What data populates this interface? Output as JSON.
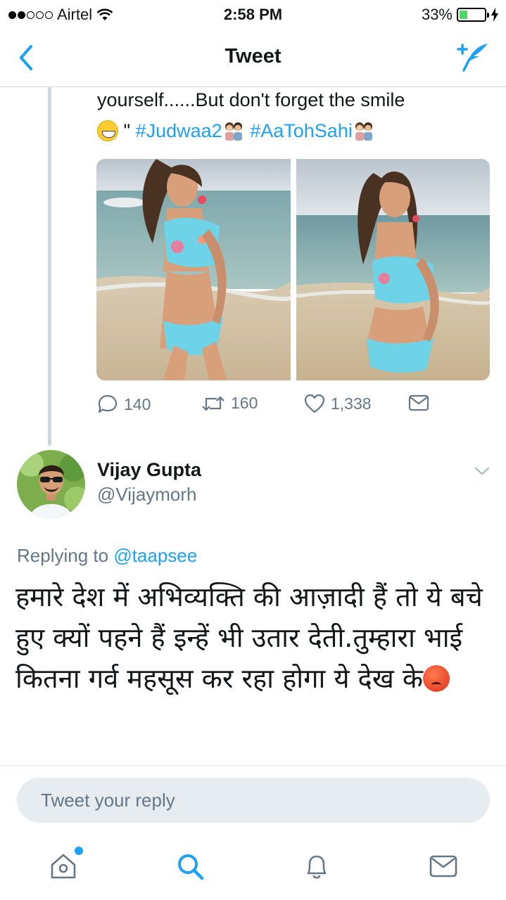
{
  "status_bar": {
    "carrier": "Airtel",
    "time": "2:58 PM",
    "battery": "33%",
    "battery_level": 0.33
  },
  "nav": {
    "title": "Tweet",
    "back_icon": "chevron-left-icon",
    "compose_icon": "compose-feather-icon"
  },
  "tweet": {
    "text_line1": "yourself......But don't forget the smile",
    "quote_mark": " \" ",
    "hashtag1": "#Judwaa2",
    "hashtag2": "#AaTohSahi",
    "replies": "140",
    "retweets": "160",
    "likes": "1,338"
  },
  "reply": {
    "name": "Vijay Gupta",
    "handle": "@Vijaymorh",
    "replying_prefix": "Replying to ",
    "replying_to": "@taapsee",
    "text": "हमारे देश में अभिव्यक्ति की आज़ादी हैं तो ये बचे हुए क्यों पहने हैं इन्हें भी उतार देती.तुम्हारा भाई कितना गर्व महसूस कर रहा होगा ये देख के"
  },
  "reply_input": {
    "placeholder": "Tweet your reply"
  },
  "colors": {
    "accent": "#1da1f2",
    "secondary_text": "#657786",
    "battery_green": "#4cd964"
  }
}
